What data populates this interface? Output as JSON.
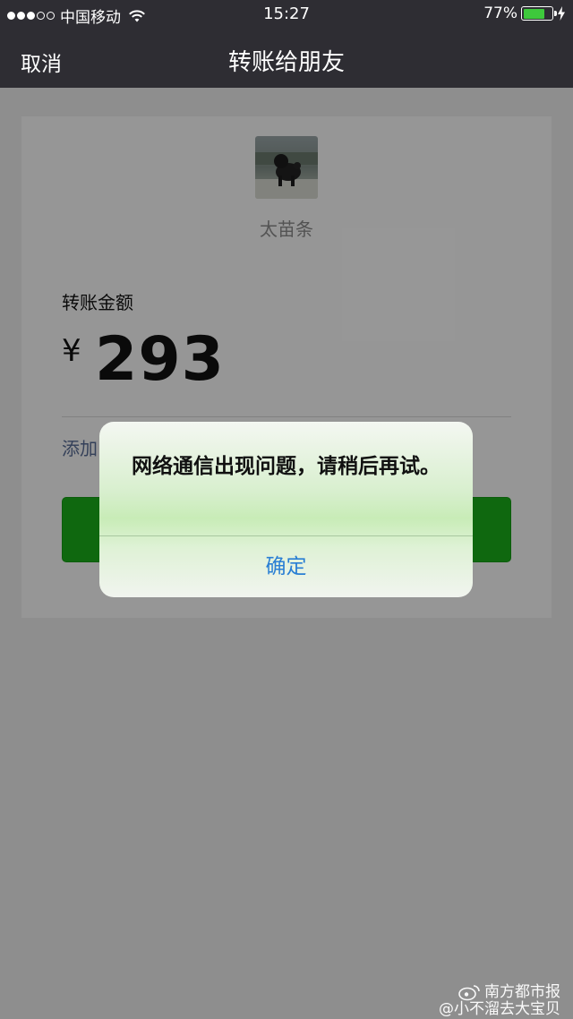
{
  "status_bar": {
    "carrier": "中国移动",
    "time": "15:27",
    "battery": "77%",
    "battery_level": 0.77
  },
  "nav": {
    "cancel_label": "取消",
    "title": "转账给朋友"
  },
  "payee": {
    "name": "太苗条"
  },
  "transfer": {
    "amount_label": "转账金额",
    "currency_symbol": "¥",
    "amount": "293",
    "note_link": "添加"
  },
  "alert": {
    "message": "网络通信出现问题，请稍后再试。",
    "confirm_label": "确定"
  },
  "watermark": {
    "line1": "南方都市报",
    "line2": "@小不溜去大宝贝"
  },
  "colors": {
    "nav_bg": "#2e2d33",
    "primary_green": "#1aad19",
    "link_blue": "#2a7fd4",
    "battery_green": "#3ec93c"
  }
}
